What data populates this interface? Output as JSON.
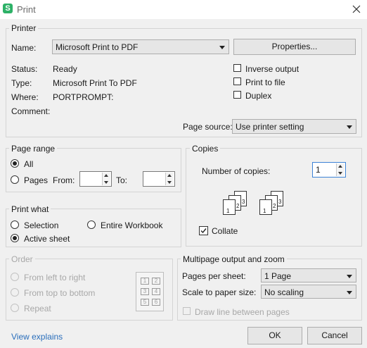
{
  "window": {
    "title": "Print",
    "app_icon_letter": "S"
  },
  "printer": {
    "group_title": "Printer",
    "name_label": "Name:",
    "name_value": "Microsoft Print to PDF",
    "properties_button": "Properties...",
    "status_label": "Status:",
    "status_value": "Ready",
    "type_label": "Type:",
    "type_value": "Microsoft Print To PDF",
    "where_label": "Where:",
    "where_value": "PORTPROMPT:",
    "comment_label": "Comment:",
    "comment_value": "",
    "inverse_output": {
      "label": "Inverse output",
      "checked": false
    },
    "print_to_file": {
      "label": "Print to file",
      "checked": false
    },
    "duplex": {
      "label": "Duplex",
      "checked": false
    },
    "page_source_label": "Page source:",
    "page_source_value": "Use printer setting"
  },
  "page_range": {
    "group_title": "Page range",
    "all_label": "All",
    "pages_label": "Pages",
    "from_label": "From:",
    "to_label": "To:",
    "from_value": "",
    "to_value": "",
    "selected": "All"
  },
  "copies": {
    "group_title": "Copies",
    "number_label": "Number of copies:",
    "number_value": "1",
    "collate_label": "Collate",
    "collate_checked": true,
    "stack_numbers": [
      "1",
      "2",
      "3"
    ]
  },
  "print_what": {
    "group_title": "Print what",
    "selection_label": "Selection",
    "entire_workbook_label": "Entire Workbook",
    "active_sheet_label": "Active sheet",
    "selected": "Active sheet"
  },
  "order": {
    "group_title": "Order",
    "left_to_right": "From left to right",
    "top_to_bottom": "From top to bottom",
    "repeat": "Repeat",
    "preview_numbers": [
      "1",
      "2",
      "3",
      "4",
      "5",
      "6"
    ]
  },
  "multipage": {
    "group_title": "Multipage output and zoom",
    "pages_per_sheet_label": "Pages per sheet:",
    "pages_per_sheet_value": "1 Page",
    "scale_label": "Scale to paper size:",
    "scale_value": "No scaling",
    "draw_line_label": "Draw line between pages",
    "draw_line_checked": false
  },
  "footer": {
    "view_explains": "View explains",
    "ok_button": "OK",
    "cancel_button": "Cancel"
  },
  "colors": {
    "app_icon": "#2db167",
    "link": "#2a6ebb",
    "focus_border": "#3c82d6"
  }
}
